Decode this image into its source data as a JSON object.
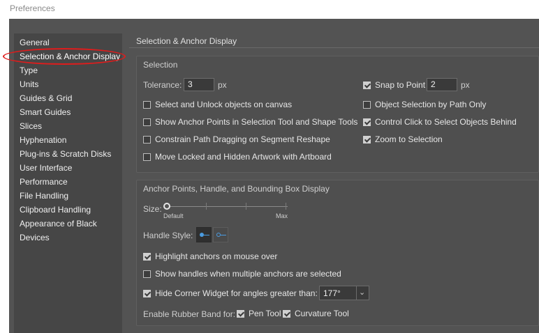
{
  "window": {
    "title": "Preferences"
  },
  "sidebar": {
    "items": [
      {
        "label": "General"
      },
      {
        "label": "Selection & Anchor Display"
      },
      {
        "label": "Type"
      },
      {
        "label": "Units"
      },
      {
        "label": "Guides & Grid"
      },
      {
        "label": "Smart Guides"
      },
      {
        "label": "Slices"
      },
      {
        "label": "Hyphenation"
      },
      {
        "label": "Plug-ins & Scratch Disks"
      },
      {
        "label": "User Interface"
      },
      {
        "label": "Performance"
      },
      {
        "label": "File Handling"
      },
      {
        "label": "Clipboard Handling"
      },
      {
        "label": "Appearance of Black"
      },
      {
        "label": "Devices"
      }
    ],
    "selected": "Selection & Anchor Display",
    "annotation_color": "#e01c1c"
  },
  "main": {
    "section_title": "Selection & Anchor Display",
    "selection": {
      "title": "Selection",
      "tolerance_label": "Tolerance:",
      "tolerance_value": "3",
      "tolerance_unit": "px",
      "snap_to_point": {
        "label": "Snap to Point",
        "checked": true,
        "value": "2",
        "unit": "px"
      },
      "options_left": [
        {
          "label": "Select and Unlock objects on canvas",
          "checked": false
        },
        {
          "label": "Show Anchor Points in Selection Tool and Shape Tools",
          "checked": false
        },
        {
          "label": "Constrain Path Dragging on Segment Reshape",
          "checked": false
        },
        {
          "label": "Move Locked and Hidden Artwork with Artboard",
          "checked": false
        }
      ],
      "options_right": [
        {
          "label": "Object Selection by Path Only",
          "checked": false
        },
        {
          "label": "Control Click to Select Objects Behind",
          "checked": true
        },
        {
          "label": "Zoom to Selection",
          "checked": true
        }
      ]
    },
    "anchor": {
      "title": "Anchor Points, Handle, and Bounding Box Display",
      "size_label": "Size:",
      "size_min_label": "Default",
      "size_max_label": "Max",
      "size_level": 0,
      "handle_style_label": "Handle Style:",
      "handle_style_selected": 0,
      "highlight_anchors": {
        "label": "Highlight anchors on mouse over",
        "checked": true
      },
      "show_handles": {
        "label": "Show handles when multiple anchors are selected",
        "checked": false
      },
      "hide_corner_widget": {
        "label": "Hide Corner Widget for angles greater than:",
        "checked": true,
        "value": "177°"
      },
      "rubber_band_label": "Enable Rubber Band for:",
      "pen_tool": {
        "label": "Pen Tool",
        "checked": true
      },
      "curvature_tool": {
        "label": "Curvature Tool",
        "checked": true
      }
    }
  },
  "colors": {
    "dialog_bg": "#535353",
    "sidebar_bg": "#464646",
    "accent": "#4a9be0"
  }
}
